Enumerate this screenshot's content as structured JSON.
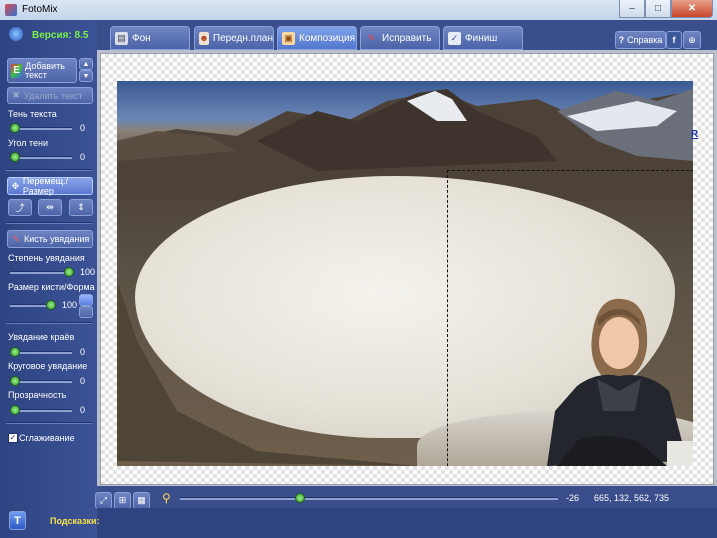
{
  "window": {
    "title": "FotoMix",
    "minimize": "–",
    "maximize": "□",
    "close": "✕"
  },
  "version_label": "Версия: 8.5",
  "tabs": [
    {
      "label": "Фон",
      "icon": "background-icon"
    },
    {
      "label": "Передн.план",
      "icon": "foreground-icon"
    },
    {
      "label": "Композиция",
      "icon": "composition-icon",
      "active": true
    },
    {
      "label": "Исправить",
      "icon": "fix-brush-icon"
    },
    {
      "label": "Финиш",
      "icon": "finish-icon"
    }
  ],
  "help_label": "Справка",
  "left_panel": {
    "add_text": "Добавить текст",
    "remove_text": "Удалить текст",
    "text_shadow": "Тень текста",
    "text_shadow_value": "0",
    "shadow_angle": "Угол тени",
    "shadow_angle_value": "0",
    "move_resize": "Перемещ./Размер",
    "fade_brush": "Кисть увядания",
    "fade_degree": "Степень увядания",
    "fade_degree_value": "100",
    "brush_size_shape": "Размер кисти/Форма",
    "brush_size_value": "100",
    "edge_fade": "Увядание краёв",
    "edge_fade_value": "0",
    "circular_fade": "Круговое увядание",
    "circular_fade_value": "0",
    "transparency": "Прозрачность",
    "transparency_value": "0",
    "smoothing": "Сглаживание",
    "smoothing_checked": true
  },
  "sliders": {
    "text_shadow": 0,
    "shadow_angle": 0,
    "fade_degree": 1.0,
    "brush_size": 1.0,
    "edge_fade": 0,
    "circular_fade": 0,
    "transparency": 0,
    "zoom": 0.31
  },
  "canvas": {
    "selection_marker": "R"
  },
  "bottom": {
    "zoom_value": "-26",
    "coords": "665, 132, 562, 735"
  },
  "status": {
    "hints_label": "Подсказки:"
  },
  "colors": {
    "accent_yellow": "#f7e24a",
    "panel_blue": "#3a4e8c",
    "version_green": "#7cf04a"
  }
}
